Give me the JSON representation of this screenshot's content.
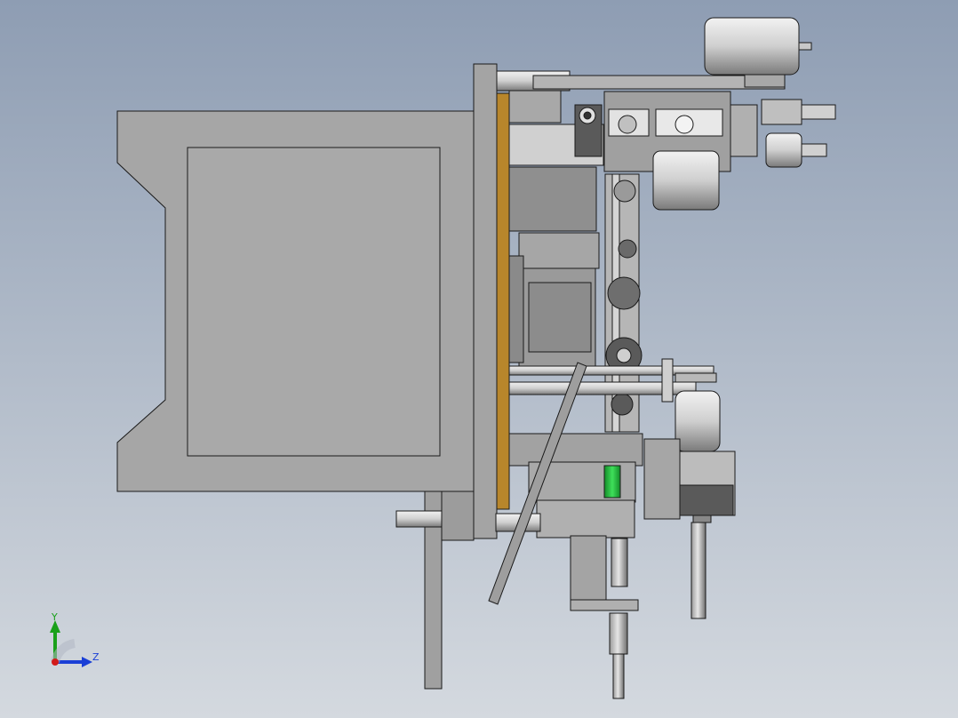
{
  "viewport": {
    "background_top": "#8e9db3",
    "background_bottom": "#d4d9df"
  },
  "colors": {
    "frame_grey": "#a6a6a6",
    "panel_grey": "#a9a9a9",
    "line": "#1a1a1a",
    "mount_plate_bronze": "#b8862b",
    "highlight_green": "#2fd14a",
    "motor_silver": "#d9d9d9",
    "dark_metal": "#4a4a4a"
  },
  "triad": {
    "y_label": "Y",
    "z_label": "Z",
    "y_color": "#1aa01a",
    "z_color": "#1a3fd6",
    "x_color": "#d21a1a"
  }
}
